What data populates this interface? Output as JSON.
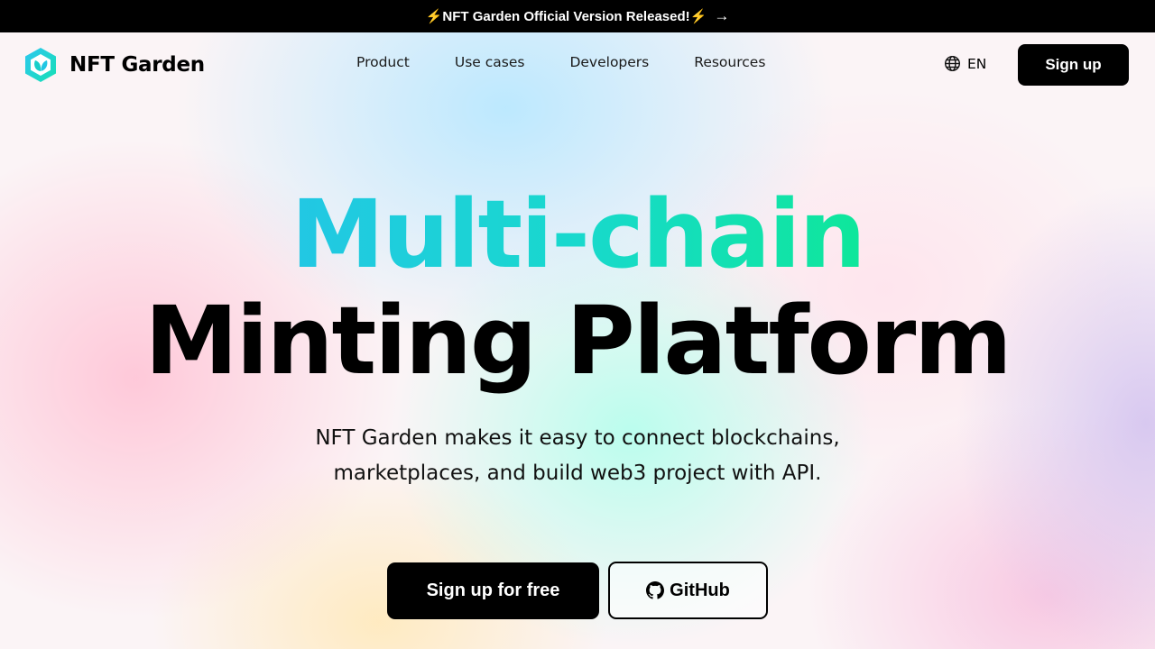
{
  "announcement": {
    "text": "NFT Garden Official Version Released!",
    "bolt_left": "⚡",
    "bolt_right": "⚡",
    "arrow": "→"
  },
  "brand": {
    "name": "NFT Garden",
    "logo_icon": "leaf-hexagon-icon",
    "colors": {
      "logo_from": "#2ec7f0",
      "logo_to": "#16e0b4"
    }
  },
  "nav": {
    "items": [
      {
        "label": "Product"
      },
      {
        "label": "Use cases"
      },
      {
        "label": "Developers"
      },
      {
        "label": "Resources"
      }
    ]
  },
  "header_actions": {
    "language": "EN",
    "language_icon": "globe-icon",
    "signup_label": "Sign up"
  },
  "hero": {
    "title_accent": "Multi-chain",
    "title_main": "Minting Platform",
    "subtitle_line1": "NFT Garden makes it easy to connect blockchains,",
    "subtitle_line2": "marketplaces, and build web3 project with API.",
    "primary_cta": "Sign up for free",
    "secondary_cta": "GitHub",
    "secondary_cta_icon": "github-icon",
    "colors": {
      "accent_from": "#22c7e4",
      "accent_to": "#0ee79a",
      "button": "#000000"
    }
  }
}
